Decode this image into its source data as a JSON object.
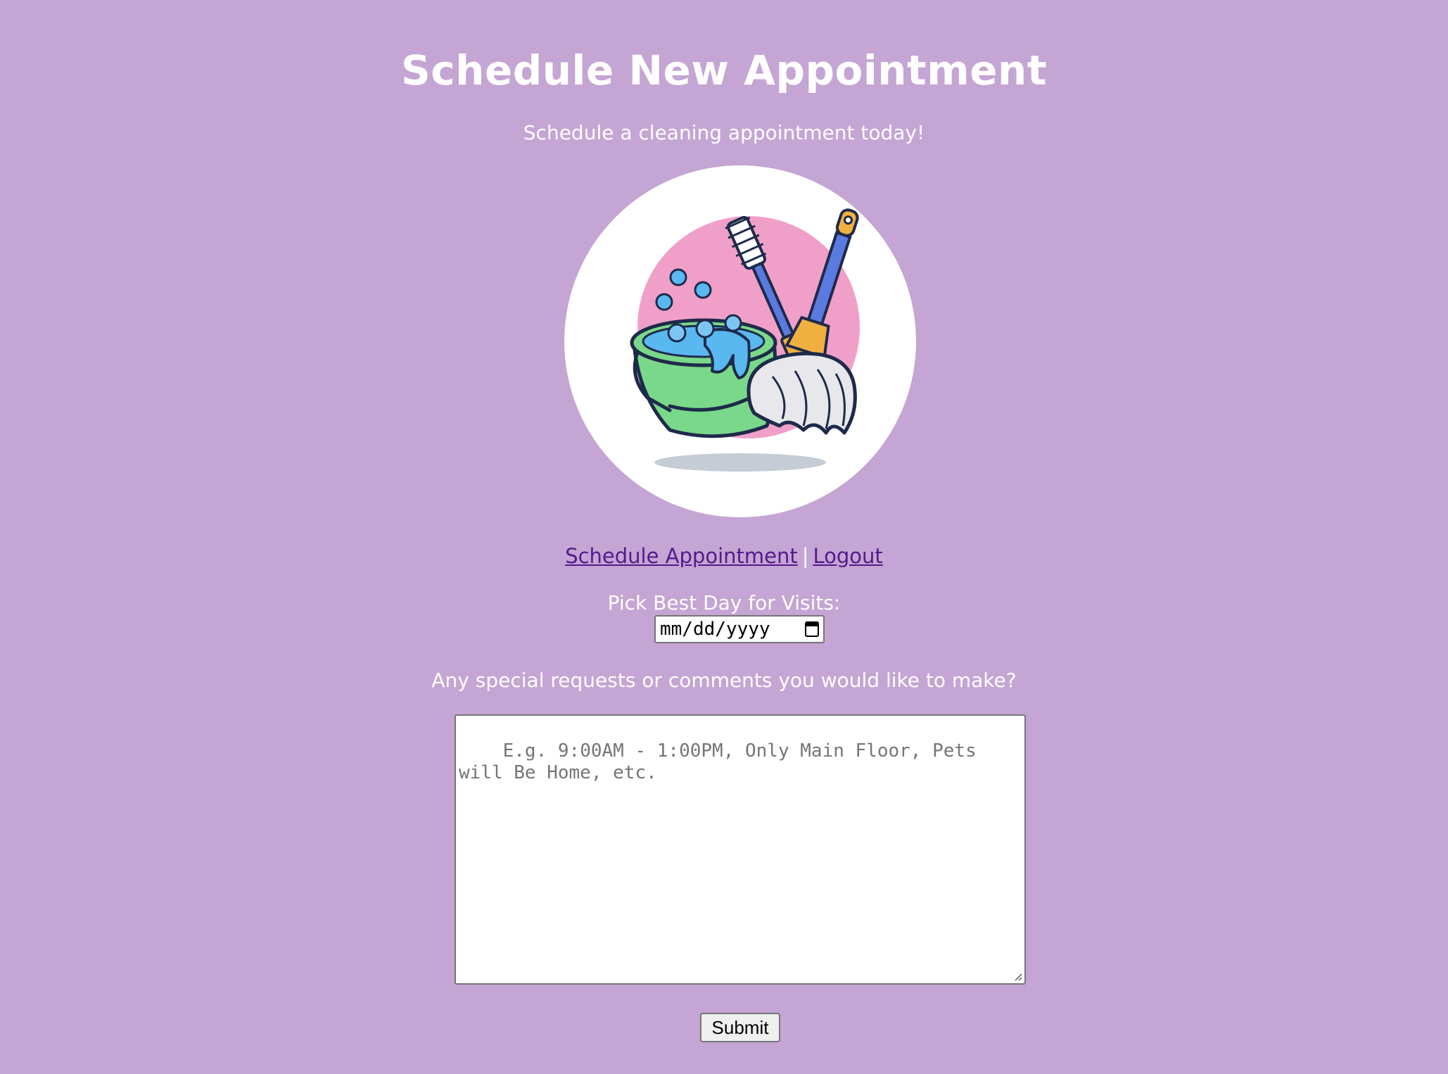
{
  "header": {
    "title": "Schedule New Appointment",
    "subtitle": "Schedule a cleaning appointment today!"
  },
  "logo": {
    "icon": "cleaning-supplies-icon",
    "colors": {
      "circle": "#ffffff",
      "blob": "#f0a0c8",
      "bucket": "#7ad88a",
      "water": "#5ab8f0",
      "brush_handle": "#5a7ae0",
      "ferrule": "#f0b040",
      "mop": "#e8e8ec",
      "outline": "#1e2a4a",
      "shadow": "#c5ccd6"
    }
  },
  "nav": {
    "schedule_link": "Schedule Appointment",
    "separator": "|",
    "logout_link": "Logout"
  },
  "form": {
    "date_label": "Pick Best Day for Visits:",
    "date_placeholder": "mm/dd/yyyy",
    "comments_label": "Any special requests or comments you would like to make?",
    "comments_placeholder": "E.g. 9:00AM - 1:00PM, Only Main Floor, Pets will Be Home, etc.",
    "submit_label": "Submit"
  },
  "colors": {
    "background": "#c4a5d4",
    "text": "#ffffff",
    "link": "#551a8b"
  }
}
